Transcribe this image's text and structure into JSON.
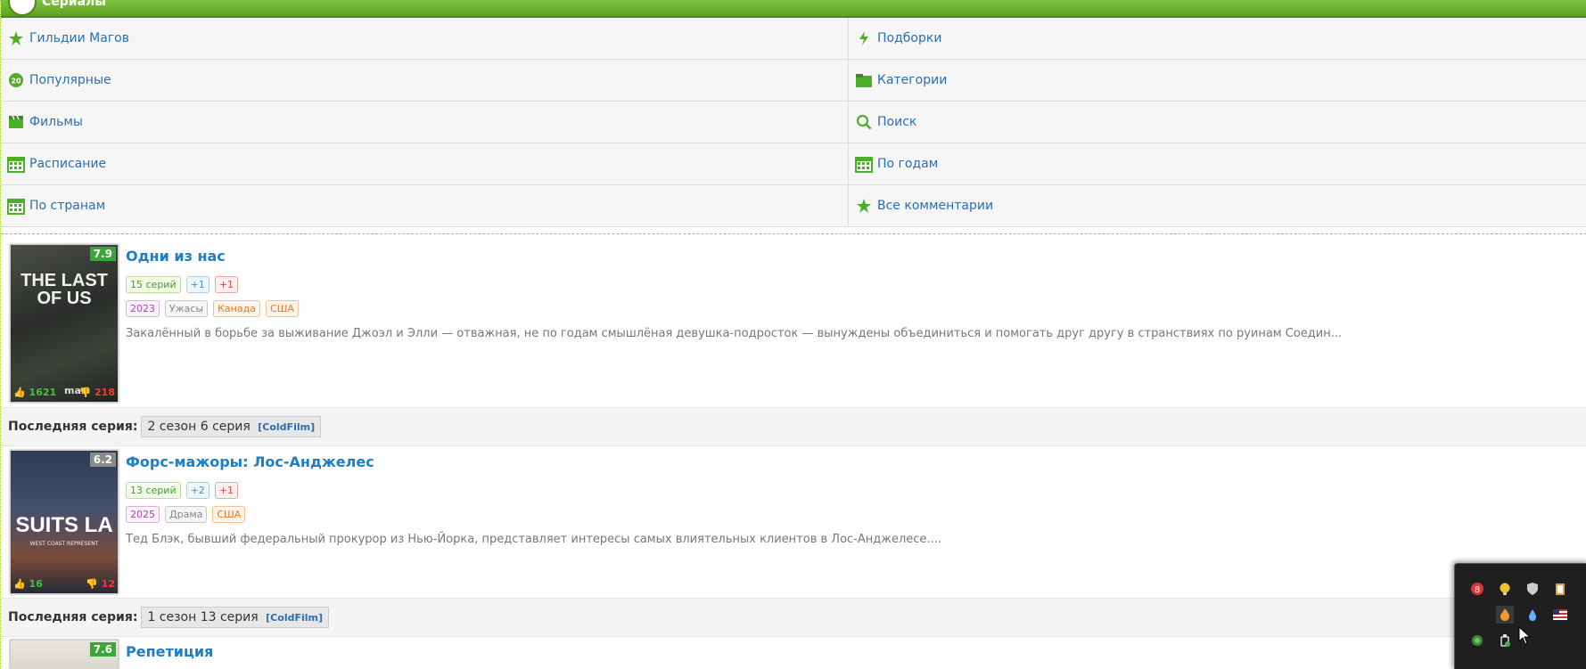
{
  "header": {
    "title": "Сериалы"
  },
  "nav": {
    "rows": [
      [
        {
          "label": "Гильдии Магов",
          "icon": "star-sparkle-icon"
        },
        {
          "label": "Подборки",
          "icon": "lightning-icon"
        }
      ],
      [
        {
          "label": "Популярные",
          "icon": "popular-20-icon"
        },
        {
          "label": "Категории",
          "icon": "folder-icon"
        }
      ],
      [
        {
          "label": "Фильмы",
          "icon": "clapperboard-icon"
        },
        {
          "label": "Поиск",
          "icon": "search-icon"
        }
      ],
      [
        {
          "label": "Расписание",
          "icon": "calendar-icon"
        },
        {
          "label": "По годам",
          "icon": "calendar-icon"
        }
      ],
      [
        {
          "label": "По странам",
          "icon": "calendar-icon"
        },
        {
          "label": "Все комментарии",
          "icon": "star-sparkle-icon"
        }
      ]
    ]
  },
  "shows": [
    {
      "title": "Одни из нас",
      "rating": "7.9",
      "rating_color": "#3aa63a",
      "likes": "1621",
      "dislikes": "218",
      "poster_text": "THE LAST OF US",
      "poster_sub": "max",
      "badges": [
        {
          "text": "15 серий",
          "style": "green"
        },
        {
          "text": "+1",
          "style": "blue"
        },
        {
          "text": "+1",
          "style": "red"
        }
      ],
      "tags": [
        {
          "text": "2023",
          "style": "purple"
        },
        {
          "text": "Ужасы",
          "style": "gray"
        },
        {
          "text": "Канада",
          "style": "orange"
        },
        {
          "text": "США",
          "style": "orange"
        }
      ],
      "description": "Закалённый в борьбе за выживание Джоэл и Элли — отважная, не по годам смышлёная девушка-подросток — вынуждены объединиться и помогать друг другу в странствиях по руинам Соедин...",
      "last_label": "Последняя серия:",
      "last_episode": "2 сезон 6 серия",
      "last_source": "[ColdFilm]"
    },
    {
      "title": "Форс-мажоры: Лос-Анджелес",
      "rating": "6.2",
      "rating_color": "#8a8a8a",
      "likes": "16",
      "dislikes": "12",
      "poster_text": "SUITS LA",
      "poster_sub": "WEST COAST REPRESENT",
      "badges": [
        {
          "text": "13 серий",
          "style": "green"
        },
        {
          "text": "+2",
          "style": "blue"
        },
        {
          "text": "+1",
          "style": "red"
        }
      ],
      "tags": [
        {
          "text": "2025",
          "style": "purple"
        },
        {
          "text": "Драма",
          "style": "gray"
        },
        {
          "text": "США",
          "style": "orange"
        }
      ],
      "description": "Тед Блэк, бывший федеральный прокурор из Нью-Йорка, представляет интересы самых влиятельных клиентов в Лос-Анджелесе....",
      "last_label": "Последняя серия:",
      "last_episode": "1 сезон 13 серия",
      "last_source": "[ColdFilm]"
    },
    {
      "title": "Репетиция",
      "rating": "7.6",
      "rating_color": "#3aa63a"
    }
  ],
  "tray_icons": [
    "guard-icon",
    "bulb-icon",
    "shield-icon",
    "clipboard-icon",
    "flame-app-icon",
    "drop-icon",
    "flag-us-icon",
    "network-icon",
    "usb-eject-icon"
  ]
}
